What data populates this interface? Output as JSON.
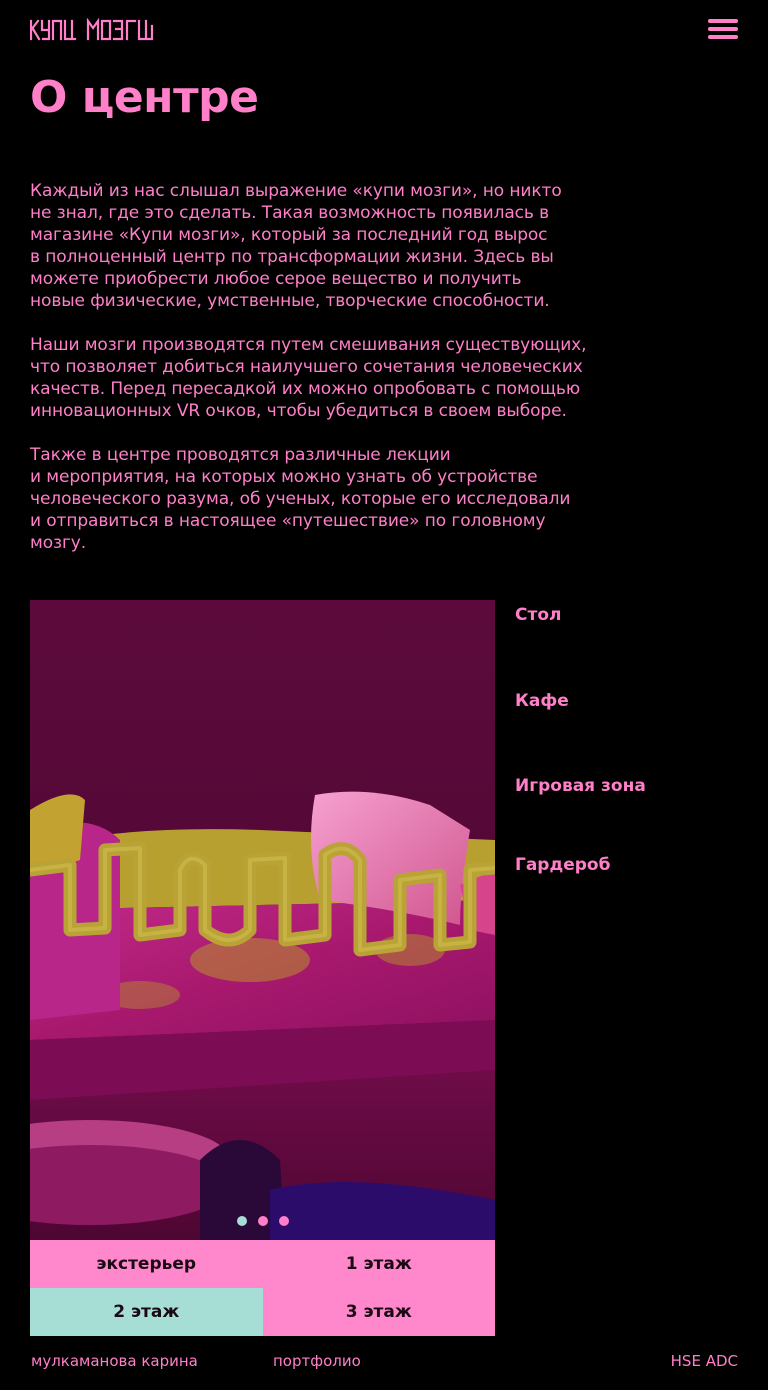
{
  "header": {
    "logo_text": "КУПИ МОЗГИ",
    "menu_icon": "hamburger-icon"
  },
  "page": {
    "title": "О центре"
  },
  "content": {
    "paragraph_1": "Каждый из нас слышал выражение «купи мозги», но никто\nне знал, где это сделать. Такая возможность появилась в\nмагазине «Купи мозги», который за последний год вырос\nв полноценный центр по трансформации жизни. Здесь вы\nможете приобрести любое серое вещество и получить\nновые физические, умственные, творческие способности.",
    "paragraph_2": "Наши мозги производятся путем смешивания существующих,\nчто позволяет добиться наилучшего сочетания человеческих\nкачеств. Перед пересадкой их можно опробовать с помощью\nинновационных VR очков, чтобы убедиться в своем выборе.",
    "paragraph_3": "Также в центре проводятся различные лекции\nи мероприятия, на которых можно узнать об устройстве\nчеловеческого разума, об ученых, которые его исследовали\nи отправиться в настоящее «путешествие» по головному\nмозгу."
  },
  "gallery": {
    "slide_count": 3,
    "active_slide": 0
  },
  "floor_tabs": [
    {
      "label": "экстерьер",
      "active": false
    },
    {
      "label": "1 этаж",
      "active": false
    },
    {
      "label": "2 этаж",
      "active": true
    },
    {
      "label": "3 этаж",
      "active": false
    }
  ],
  "zones": [
    {
      "label": "Стол"
    },
    {
      "label": "Кафе"
    },
    {
      "label": "Игровая зона"
    },
    {
      "label": "Гардероб"
    }
  ],
  "footer": {
    "author": "мулкаманова карина",
    "portfolio": "портфолио",
    "school": "HSE ADC"
  },
  "colors": {
    "background": "#000000",
    "accent_pink": "#ff7fc8",
    "accent_mint": "#a6ded6",
    "dark_text": "#1a0a14",
    "scene_purple": "#5a0a3a",
    "scene_yellow": "#b8a030"
  }
}
